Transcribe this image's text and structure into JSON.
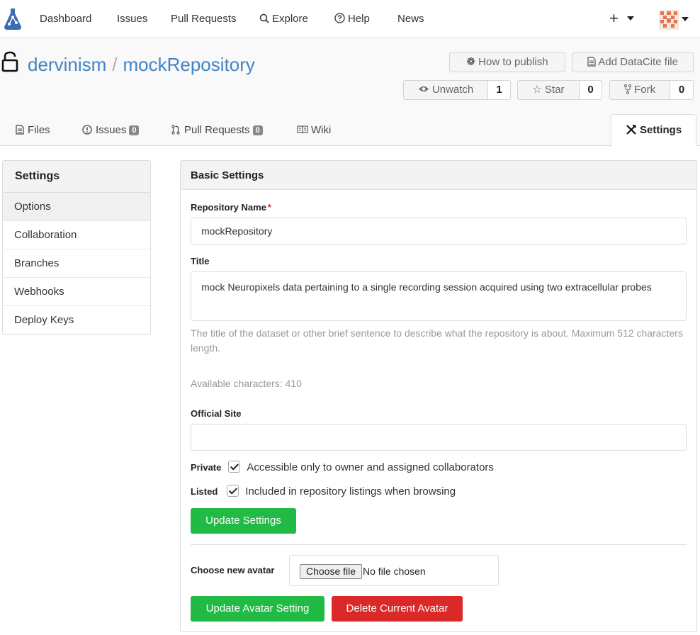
{
  "nav": {
    "items": [
      "Dashboard",
      "Issues",
      "Pull Requests",
      "Explore",
      "Help",
      "News"
    ],
    "plus": "+"
  },
  "repo": {
    "owner": "dervinism",
    "separator": "/",
    "name": "mockRepository",
    "buttons": {
      "how_to_publish": "How to publish",
      "add_datacite": "Add DataCite file",
      "unwatch": "Unwatch",
      "unwatch_count": "1",
      "star": "Star",
      "star_count": "0",
      "fork": "Fork",
      "fork_count": "0"
    }
  },
  "tabs": {
    "files": "Files",
    "issues": "Issues",
    "issues_count": "0",
    "pulls": "Pull Requests",
    "pulls_count": "0",
    "wiki": "Wiki",
    "settings": "Settings"
  },
  "menu": {
    "title": "Settings",
    "items": [
      "Options",
      "Collaboration",
      "Branches",
      "Webhooks",
      "Deploy Keys"
    ]
  },
  "form": {
    "heading": "Basic Settings",
    "repo_name_label": "Repository Name",
    "required_mark": "*",
    "repo_name_value": "mockRepository",
    "title_label": "Title",
    "title_value": "mock Neuropixels data pertaining to a single recording session acquired using two extracellular probes",
    "title_help": "The title of the dataset or other brief sentence to describe what the repository is about. Maximum 512 characters length.",
    "available_chars": "Available characters: 410",
    "official_site_label": "Official Site",
    "official_site_value": "",
    "private_label": "Private",
    "private_text": "Accessible only to owner and assigned collaborators",
    "private_checked": true,
    "listed_label": "Listed",
    "listed_text": "Included in repository listings when browsing",
    "listed_checked": true,
    "update_settings": "Update Settings",
    "avatar_label": "Choose new avatar",
    "choose_file": "Choose file",
    "no_file": "No file chosen",
    "update_avatar": "Update Avatar Setting",
    "delete_avatar": "Delete Current Avatar"
  },
  "colors": {
    "link": "#4183c4",
    "green": "#21ba45",
    "red": "#db2828"
  }
}
